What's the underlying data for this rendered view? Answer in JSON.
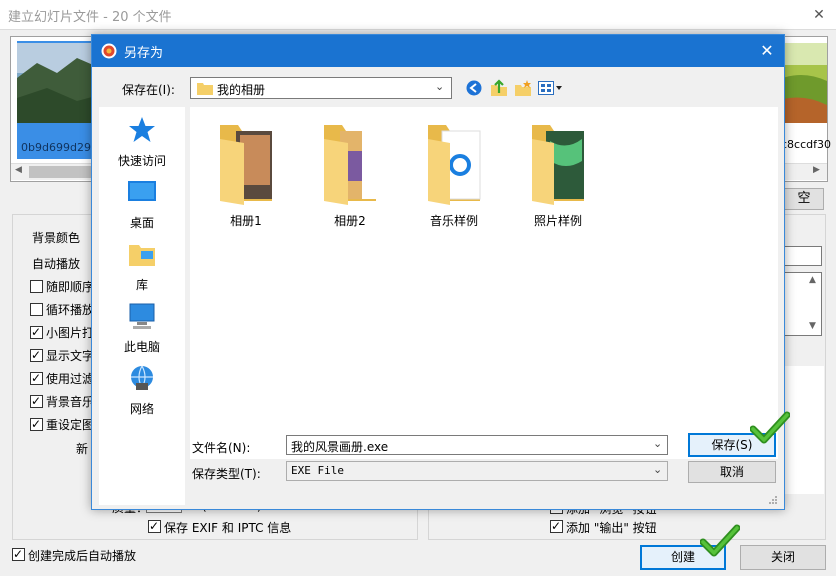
{
  "background_window": {
    "title": "建立幻灯片文件 - 20 个文件",
    "close_glyph": "✕",
    "thumbnails": [
      {
        "caption": "0b9d699d29",
        "selected": true
      },
      {
        "caption": "c8ccdf30",
        "selected": false
      }
    ],
    "right_button_label": "空",
    "options": [
      {
        "label": "背景颜色",
        "checkbox": false
      },
      {
        "label": "自动播放",
        "checkbox": false
      },
      {
        "label": "随即顺序",
        "checked": false,
        "checkbox": true
      },
      {
        "label": "循环播放",
        "checked": false,
        "checkbox": true
      },
      {
        "label": "小图片打",
        "checked": true,
        "checkbox": true
      },
      {
        "label": "显示文字",
        "checked": true,
        "checkbox": true
      },
      {
        "label": "使用过滤",
        "checked": true,
        "checkbox": true
      },
      {
        "label": "背景音乐",
        "checked": true,
        "checkbox": true
      },
      {
        "label": "重设定图",
        "checked": true,
        "checkbox": true
      }
    ],
    "partial_label": "新",
    "quality_label": "质量：",
    "quality_range": "(10 - 100)",
    "exif_label": "保存 EXIF 和 IPTC 信息",
    "add_browse_label": "添加 \"浏览\" 按钮",
    "add_output_label": "添加 \"输出\" 按钮",
    "autoplay_label": "创建完成后自动播放",
    "create_button": "创建",
    "close_button": "关闭"
  },
  "save_dialog": {
    "title": "另存为",
    "close_glyph": "✕",
    "save_in_label": "保存在(I):",
    "save_in_value": "我的相册",
    "places": [
      {
        "label": "快速访问",
        "icon": "star-icon"
      },
      {
        "label": "桌面",
        "icon": "desktop-icon"
      },
      {
        "label": "库",
        "icon": "library-icon"
      },
      {
        "label": "此电脑",
        "icon": "computer-icon"
      },
      {
        "label": "网络",
        "icon": "network-icon"
      }
    ],
    "folders": [
      {
        "label": "相册1"
      },
      {
        "label": "相册2"
      },
      {
        "label": "音乐样例"
      },
      {
        "label": "照片样例"
      }
    ],
    "filename_label": "文件名(N):",
    "filename_value": "我的风景画册.exe",
    "filetype_label": "保存类型(T):",
    "filetype_value": "EXE File",
    "save_button": "保存(S)",
    "cancel_button": "取消"
  }
}
